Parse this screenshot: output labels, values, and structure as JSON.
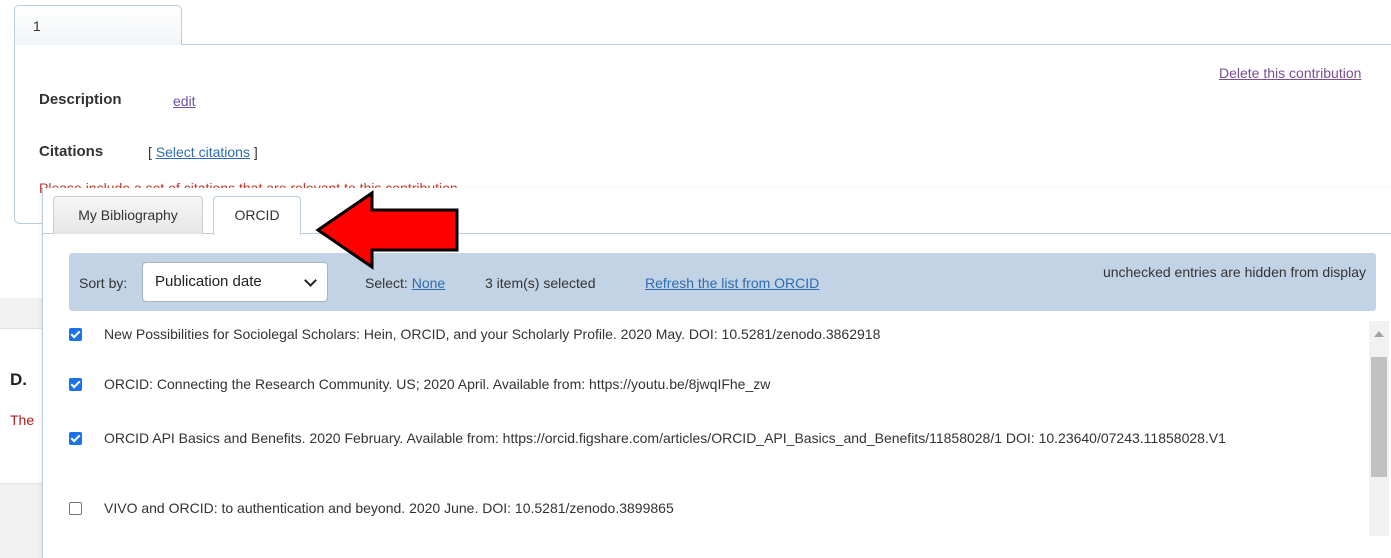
{
  "contribution": {
    "tab_label": "1",
    "delete_label": "Delete this contribution",
    "description_label": "Description",
    "edit_label": "edit",
    "citations_label": "Citations",
    "bracket_open": "[ ",
    "select_citations_label": "Select citations",
    "bracket_close": " ]",
    "warning_text": "Please include a set of citations that are relevant to this contribution"
  },
  "background_section": {
    "letter": "D.",
    "text_start": "The"
  },
  "dialog": {
    "tabs": [
      {
        "label": "My Bibliography",
        "active": false
      },
      {
        "label": "ORCID",
        "active": true
      }
    ],
    "toolbar": {
      "sort_label": "Sort by:",
      "sort_value": "Publication date",
      "select_label": "Select: ",
      "none_label": "None",
      "selected_count": "3 item(s) selected",
      "refresh_label": "Refresh the list from ORCID",
      "hidden_note": "unchecked entries are hidden from display"
    },
    "items": [
      {
        "checked": true,
        "text": "New Possibilities for Sociolegal Scholars: Hein, ORCID, and your Scholarly Profile. 2020 May. DOI: 10.5281/zenodo.3862918"
      },
      {
        "checked": true,
        "text": "ORCID: Connecting the Research Community. US; 2020 April. Available from: https://youtu.be/8jwqIFhe_zw"
      },
      {
        "checked": true,
        "text": "ORCID API Basics and Benefits. 2020 February. Available from: https://orcid.figshare.com/articles/ORCID_API_Basics_and_Benefits/11858028/1 DOI: 10.23640/07243.11858028.V1"
      },
      {
        "checked": false,
        "text": "VIVO and ORCID: to authentication and beyond. 2020 June. DOI: 10.5281/zenodo.3899865"
      }
    ]
  },
  "colors": {
    "annotation_arrow": "#ff0000",
    "toolbar_bg": "#c3d3e6",
    "link": "#2e6cb0",
    "checkbox_checked": "#1a73e8"
  },
  "icons": {
    "sort_chevron": "chevron-down-icon",
    "arrow": "red-arrow-annotation",
    "scroll": "scroll-up-icon"
  }
}
